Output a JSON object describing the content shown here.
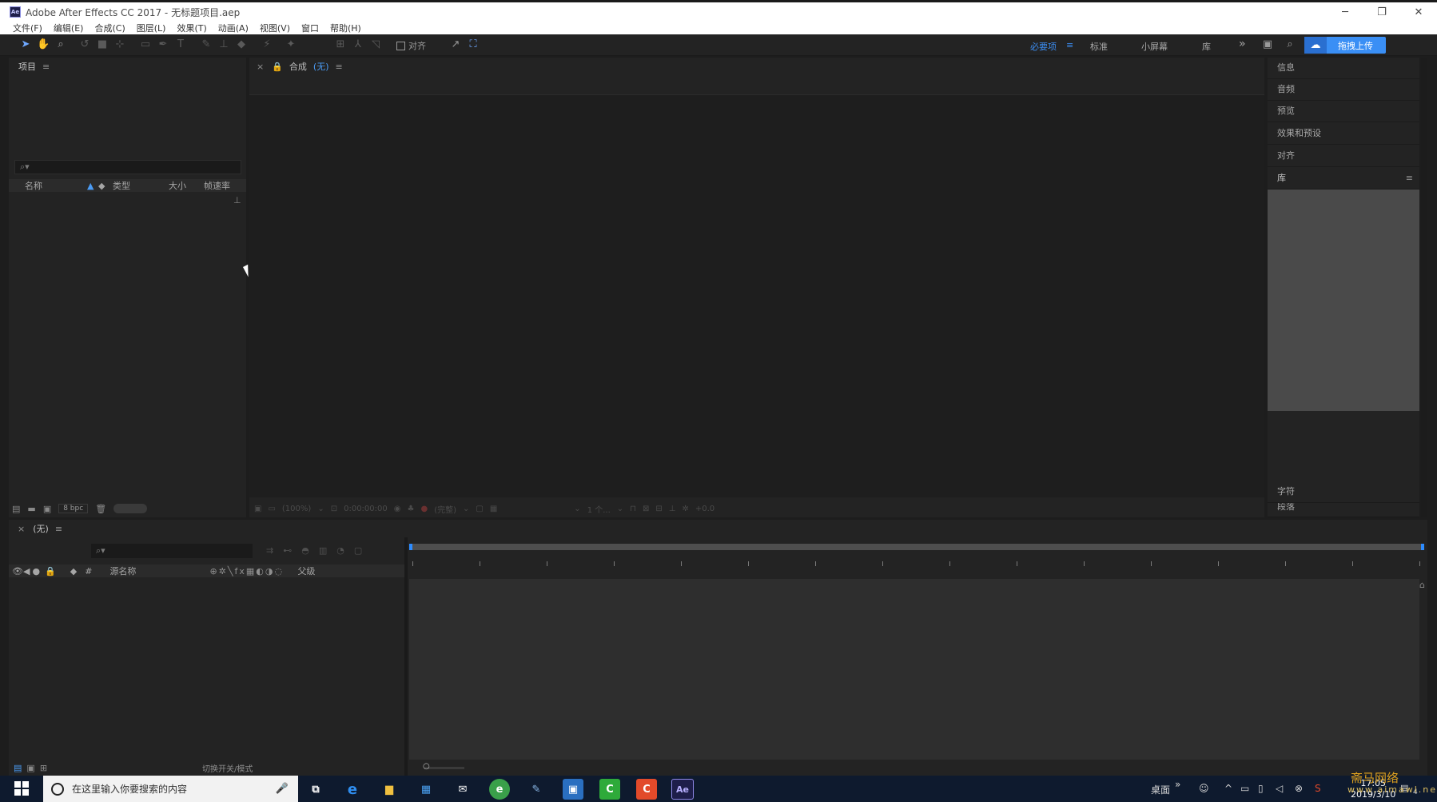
{
  "window": {
    "title": "Adobe After Effects CC 2017 - 无标题项目.aep",
    "app_icon_text": "Ae",
    "controls": [
      "─",
      "❐",
      "✕"
    ]
  },
  "menu": [
    "文件(F)",
    "编辑(E)",
    "合成(C)",
    "图层(L)",
    "效果(T)",
    "动画(A)",
    "视图(V)",
    "窗口",
    "帮助(H)"
  ],
  "toolbar": {
    "snap_label": "对齐",
    "workspaces": [
      {
        "label": "必要项",
        "active": true
      },
      {
        "label": "标准",
        "active": false
      },
      {
        "label": "小屏幕",
        "active": false
      },
      {
        "label": "库",
        "active": false
      }
    ],
    "more": "»",
    "workspace_menu": "≡",
    "upload_label": "拖拽上传"
  },
  "project_panel": {
    "title": "项目",
    "search_placeholder": "⌕▾",
    "columns": [
      "名称",
      "类型",
      "大小",
      "帧速率"
    ],
    "bpc": "8 bpc"
  },
  "comp_panel": {
    "close": "×",
    "label": "合成",
    "name": "(无)",
    "footer": [
      "(100%)",
      "0:00:00:00",
      "(完整)",
      "1 个...",
      "+0.0"
    ]
  },
  "right_panel": {
    "items": [
      "信息",
      "音频",
      "预览",
      "效果和预设",
      "对齐",
      "库"
    ],
    "bottom_items": [
      "字符",
      "段落"
    ]
  },
  "timeline": {
    "close": "×",
    "name": "(无)",
    "search_placeholder": "⌕▾",
    "columns": {
      "hash": "#",
      "source": "源名称",
      "parent": "父级"
    },
    "footer_modes": "切换开关/模式"
  },
  "taskbar": {
    "search_placeholder": "在这里输入你要搜索的内容",
    "desktop_label": "桌面",
    "time": "17:05",
    "date": "2019/3/10",
    "notification_count": "4"
  },
  "watermark": {
    "line1": "斋马网络",
    "line2": "www.aimawl.net"
  }
}
